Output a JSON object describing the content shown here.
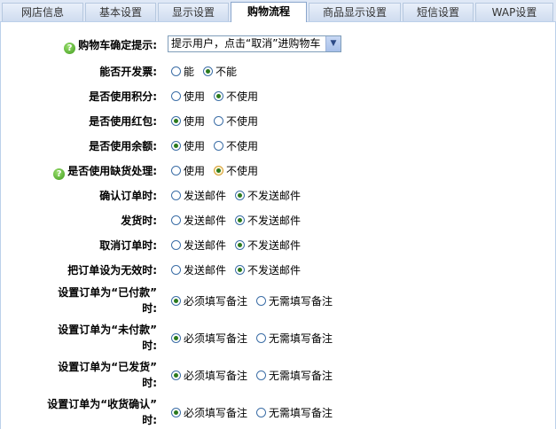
{
  "tabs": [
    "网店信息",
    "基本设置",
    "显示设置",
    "购物流程",
    "商品显示设置",
    "短信设置",
    "WAP设置"
  ],
  "active_tab": "购物流程",
  "cart_confirm": {
    "label": "购物车确定提示:",
    "value": "提示用户，点击“取消”进购物车"
  },
  "settings": [
    {
      "label": "能否开发票:",
      "options": [
        "能",
        "不能"
      ],
      "selected": 1
    },
    {
      "label": "是否使用积分:",
      "options": [
        "使用",
        "不使用"
      ],
      "selected": 1
    },
    {
      "label": "是否使用红包:",
      "options": [
        "使用",
        "不使用"
      ],
      "selected": 0
    },
    {
      "label": "是否使用余额:",
      "options": [
        "使用",
        "不使用"
      ],
      "selected": 0
    },
    {
      "label": "是否使用缺货处理:",
      "options": [
        "使用",
        "不使用"
      ],
      "selected": 1,
      "help": true
    },
    {
      "label": "确认订单时:",
      "options": [
        "发送邮件",
        "不发送邮件"
      ],
      "selected": 1
    },
    {
      "label": "发货时:",
      "options": [
        "发送邮件",
        "不发送邮件"
      ],
      "selected": 1
    },
    {
      "label": "取消订单时:",
      "options": [
        "发送邮件",
        "不发送邮件"
      ],
      "selected": 1
    },
    {
      "label": "把订单设为无效时:",
      "options": [
        "发送邮件",
        "不发送邮件"
      ],
      "selected": 1
    }
  ],
  "note_settings": [
    {
      "label_line1": "设置订单为“已付款”",
      "label_line2": "时:",
      "options": [
        "必须填写备注",
        "无需填写备注"
      ],
      "selected": 0
    },
    {
      "label_line1": "设置订单为“未付款”",
      "label_line2": "时:",
      "options": [
        "必须填写备注",
        "无需填写备注"
      ],
      "selected": 0
    },
    {
      "label_line1": "设置订单为“已发货”",
      "label_line2": "时:",
      "options": [
        "必须填写备注",
        "无需填写备注"
      ],
      "selected": 0
    },
    {
      "label_line1": "设置订单为“收货确认”",
      "label_line2": "时:",
      "options": [
        "必须填写备注",
        "无需填写备注"
      ],
      "selected": 0
    }
  ]
}
